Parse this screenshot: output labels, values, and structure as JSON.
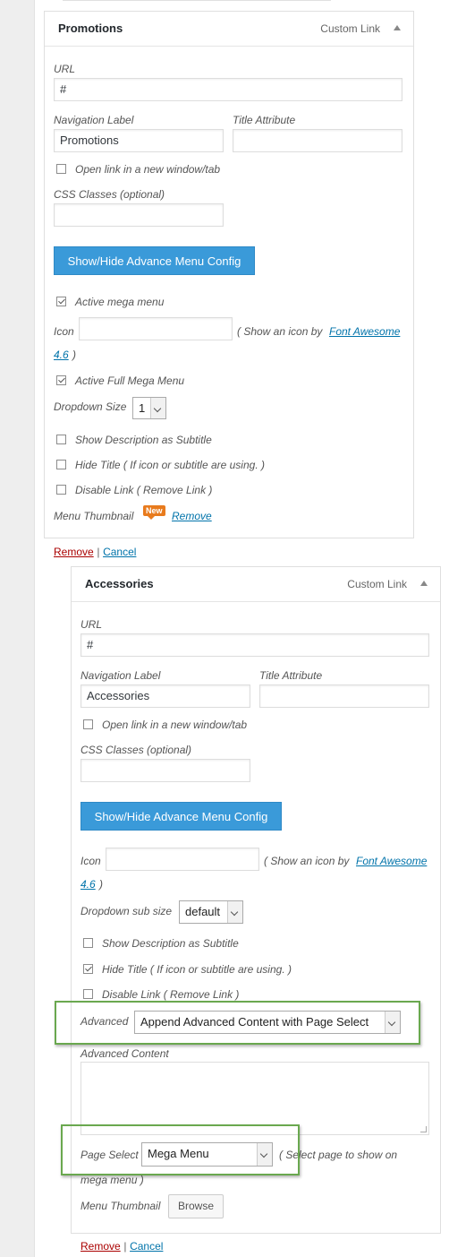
{
  "item1": {
    "title": "Promotions",
    "type": "Custom Link",
    "url_label": "URL",
    "url_value": "#",
    "nav_label": "Navigation Label",
    "nav_value": "Promotions",
    "title_attr_label": "Title Attribute",
    "title_attr_value": "",
    "new_window_label": "Open link in a new window/tab",
    "css_label": "CSS Classes (optional)",
    "css_value": "",
    "advance_btn": "Show/Hide Advance Menu Config",
    "active_mega_label": "Active mega menu",
    "icon_label": "Icon",
    "icon_value": "",
    "icon_hint_pre": "( Show an icon by",
    "icon_hint_link": "Font Awesome",
    "icon_hint_post": "4.6",
    "icon_hint_close": ")",
    "active_full_label": "Active Full Mega Menu",
    "dropdown_size_label": "Dropdown Size",
    "dropdown_size_value": "1",
    "show_desc_label": "Show Description as Subtitle",
    "hide_title_label": "Hide Title ( If icon or subtitle are using. )",
    "disable_link_label": "Disable Link ( Remove Link )",
    "thumbnail_label": "Menu Thumbnail",
    "new_badge": "New",
    "thumbnail_remove": "Remove",
    "remove": "Remove",
    "separator": "|",
    "cancel": "Cancel"
  },
  "item2": {
    "title": "Accessories",
    "type": "Custom Link",
    "url_label": "URL",
    "url_value": "#",
    "nav_label": "Navigation Label",
    "nav_value": "Accessories",
    "title_attr_label": "Title Attribute",
    "title_attr_value": "",
    "new_window_label": "Open link in a new window/tab",
    "css_label": "CSS Classes (optional)",
    "css_value": "",
    "advance_btn": "Show/Hide Advance Menu Config",
    "icon_label": "Icon",
    "icon_value": "",
    "icon_hint_pre": "( Show an icon by",
    "icon_hint_link": "Font Awesome",
    "icon_hint_post": "4.6",
    "icon_hint_close": ")",
    "dropdown_sub_label": "Dropdown sub size",
    "dropdown_sub_value": "default",
    "show_desc_label": "Show Description as Subtitle",
    "hide_title_label": "Hide Title ( If icon or subtitle are using. )",
    "disable_link_label": "Disable Link ( Remove Link )",
    "advanced_label": "Advanced",
    "advanced_value": "Append Advanced Content with Page Select",
    "advanced_content_label": "Advanced Content",
    "page_select_label": "Page Select",
    "page_select_value": "Mega Menu",
    "page_select_hint_1": "( Select page to show on",
    "page_select_hint_2": "mega menu )",
    "thumbnail_label": "Menu Thumbnail",
    "browse": "Browse",
    "remove": "Remove",
    "separator": "|",
    "cancel": "Cancel"
  },
  "colors": {
    "highlight": "#6aa84f",
    "button_blue": "#3a9ad9",
    "link": "#0073aa",
    "remove_red": "#aa0000",
    "badge_orange": "#e87b1d"
  }
}
